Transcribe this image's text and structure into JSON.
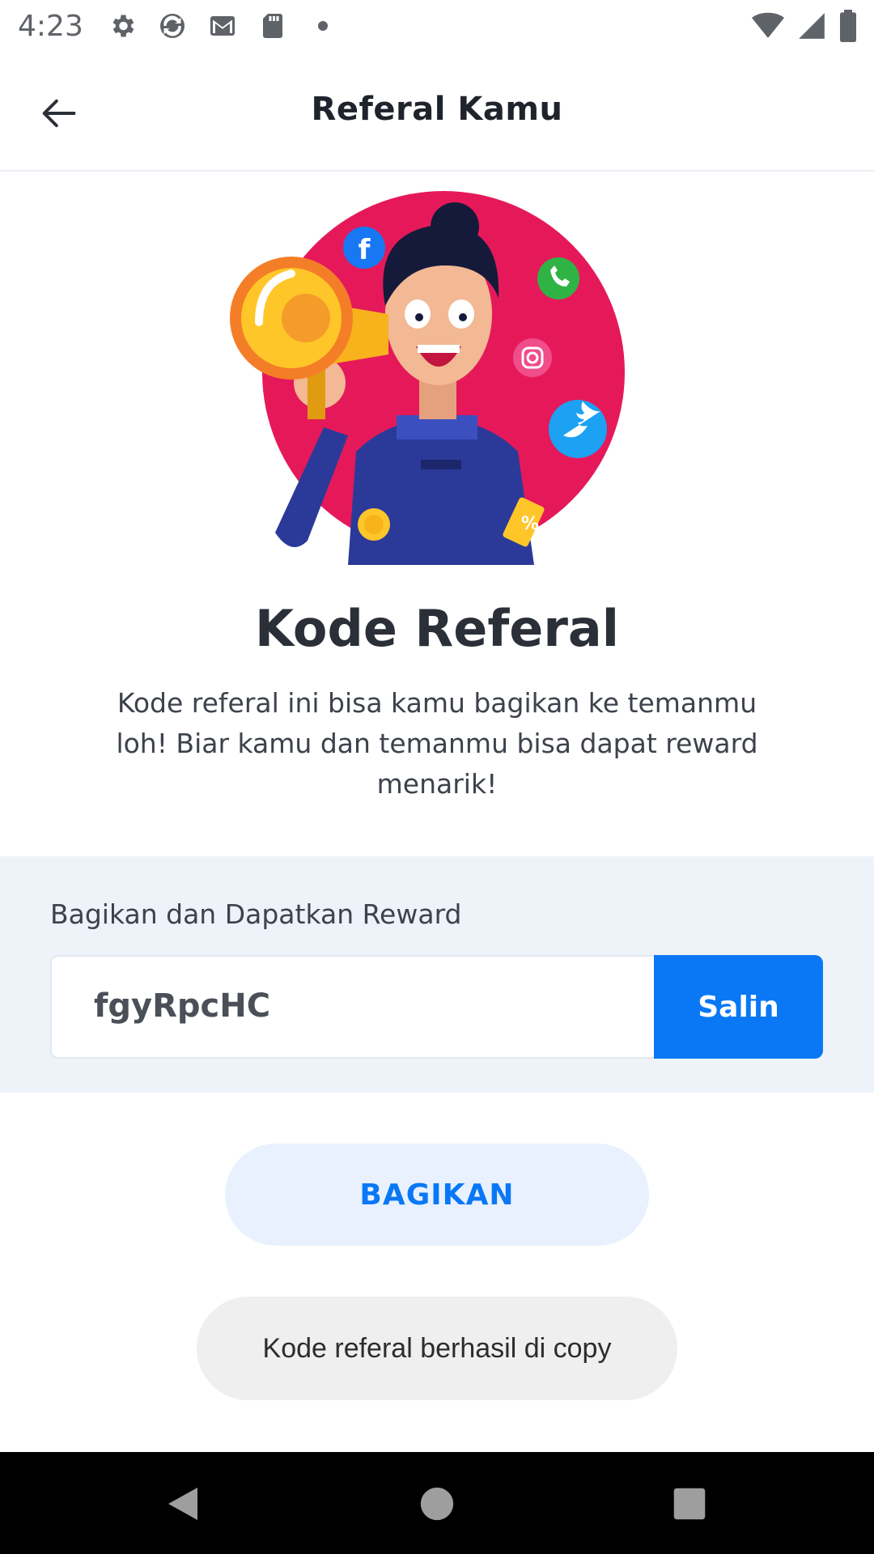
{
  "status_bar": {
    "time": "4:23",
    "left_icons": [
      "settings-icon",
      "sync-icon",
      "gmail-icon",
      "sd-card-icon",
      "dot-icon"
    ],
    "right_icons": [
      "wifi-icon",
      "signal-icon",
      "battery-icon"
    ]
  },
  "app_bar": {
    "title": "Referal Kamu",
    "back_icon": "arrow-left-icon"
  },
  "content": {
    "headline": "Kode Referal",
    "description": "Kode referal ini bisa kamu bagikan ke temanmu loh! Biar kamu dan temanmu bisa dapat reward menarik!"
  },
  "share_section": {
    "label": "Bagikan dan Dapatkan Reward",
    "referral_code": "fgyRpcHC",
    "copy_label": "Salin"
  },
  "share_button": {
    "label": "BAGIKAN"
  },
  "toast": {
    "message": "Kode referal berhasil di copy"
  },
  "colors": {
    "accent": "#0a78f5",
    "share_bg": "#eef3fa",
    "hero_circle": "#e5195a"
  },
  "nav_bar": {
    "icons": [
      "back-triangle-icon",
      "home-circle-icon",
      "recents-square-icon"
    ]
  }
}
